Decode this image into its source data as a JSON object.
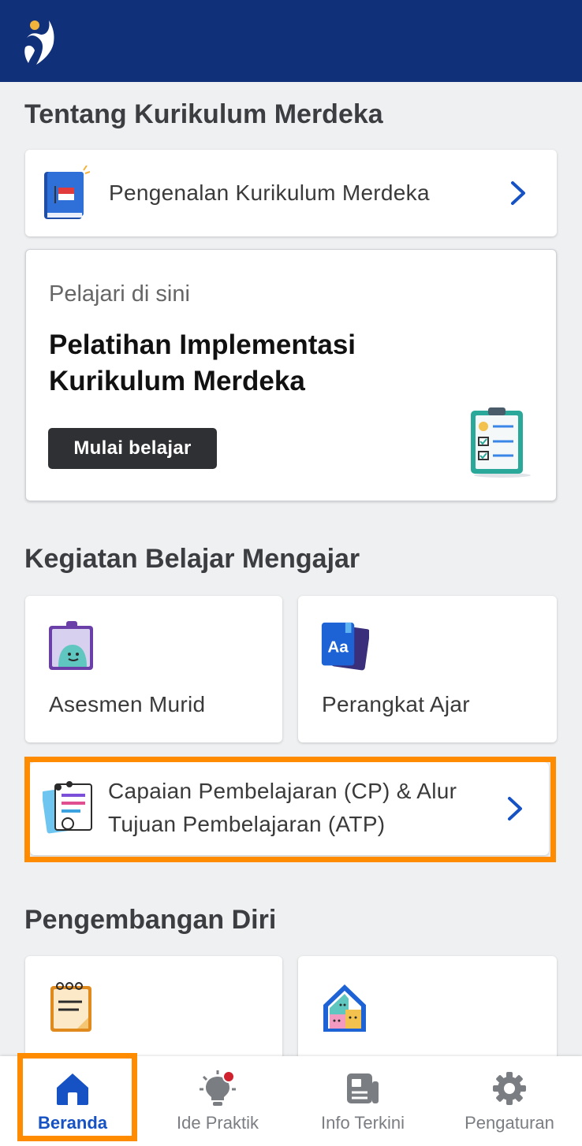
{
  "header": {
    "logo_icon": "app-logo-icon"
  },
  "section1": {
    "title": "Tentang Kurikulum Merdeka",
    "intro_card": {
      "label": "Pengenalan Kurikulum Merdeka",
      "icon": "book-flag-icon"
    },
    "promo": {
      "subtitle": "Pelajari di sini",
      "title": "Pelatihan Implementasi Kurikulum Merdeka",
      "button_label": "Mulai belajar",
      "illustration": "clipboard-checklist-icon"
    }
  },
  "section2": {
    "title": "Kegiatan Belajar Mengajar",
    "tiles": [
      {
        "label": "Asesmen Murid",
        "icon": "assessment-clipboard-icon"
      },
      {
        "label": "Perangkat Ajar",
        "icon": "teaching-kit-book-icon"
      }
    ],
    "cp_card": {
      "label_line1": "Capaian Pembelajaran (CP) & Alur",
      "label_line2": "Tujuan Pembelajaran (ATP)",
      "icon": "documents-icon"
    }
  },
  "section3": {
    "title": "Pengembangan Diri",
    "tiles": [
      {
        "label": "",
        "icon": "notepad-icon"
      },
      {
        "label": "",
        "icon": "community-house-icon"
      }
    ]
  },
  "bottom_nav": {
    "items": [
      {
        "label": "Beranda",
        "icon": "home-icon",
        "active": true
      },
      {
        "label": "Ide Praktik",
        "icon": "lightbulb-icon",
        "active": false,
        "badge": true
      },
      {
        "label": "Info Terkini",
        "icon": "news-icon",
        "active": false
      },
      {
        "label": "Pengaturan",
        "icon": "gear-icon",
        "active": false
      }
    ]
  },
  "colors": {
    "header_bg": "#10307a",
    "accent_blue": "#1652c3",
    "highlight_orange": "#ff8c00",
    "badge_red": "#d0212f"
  }
}
